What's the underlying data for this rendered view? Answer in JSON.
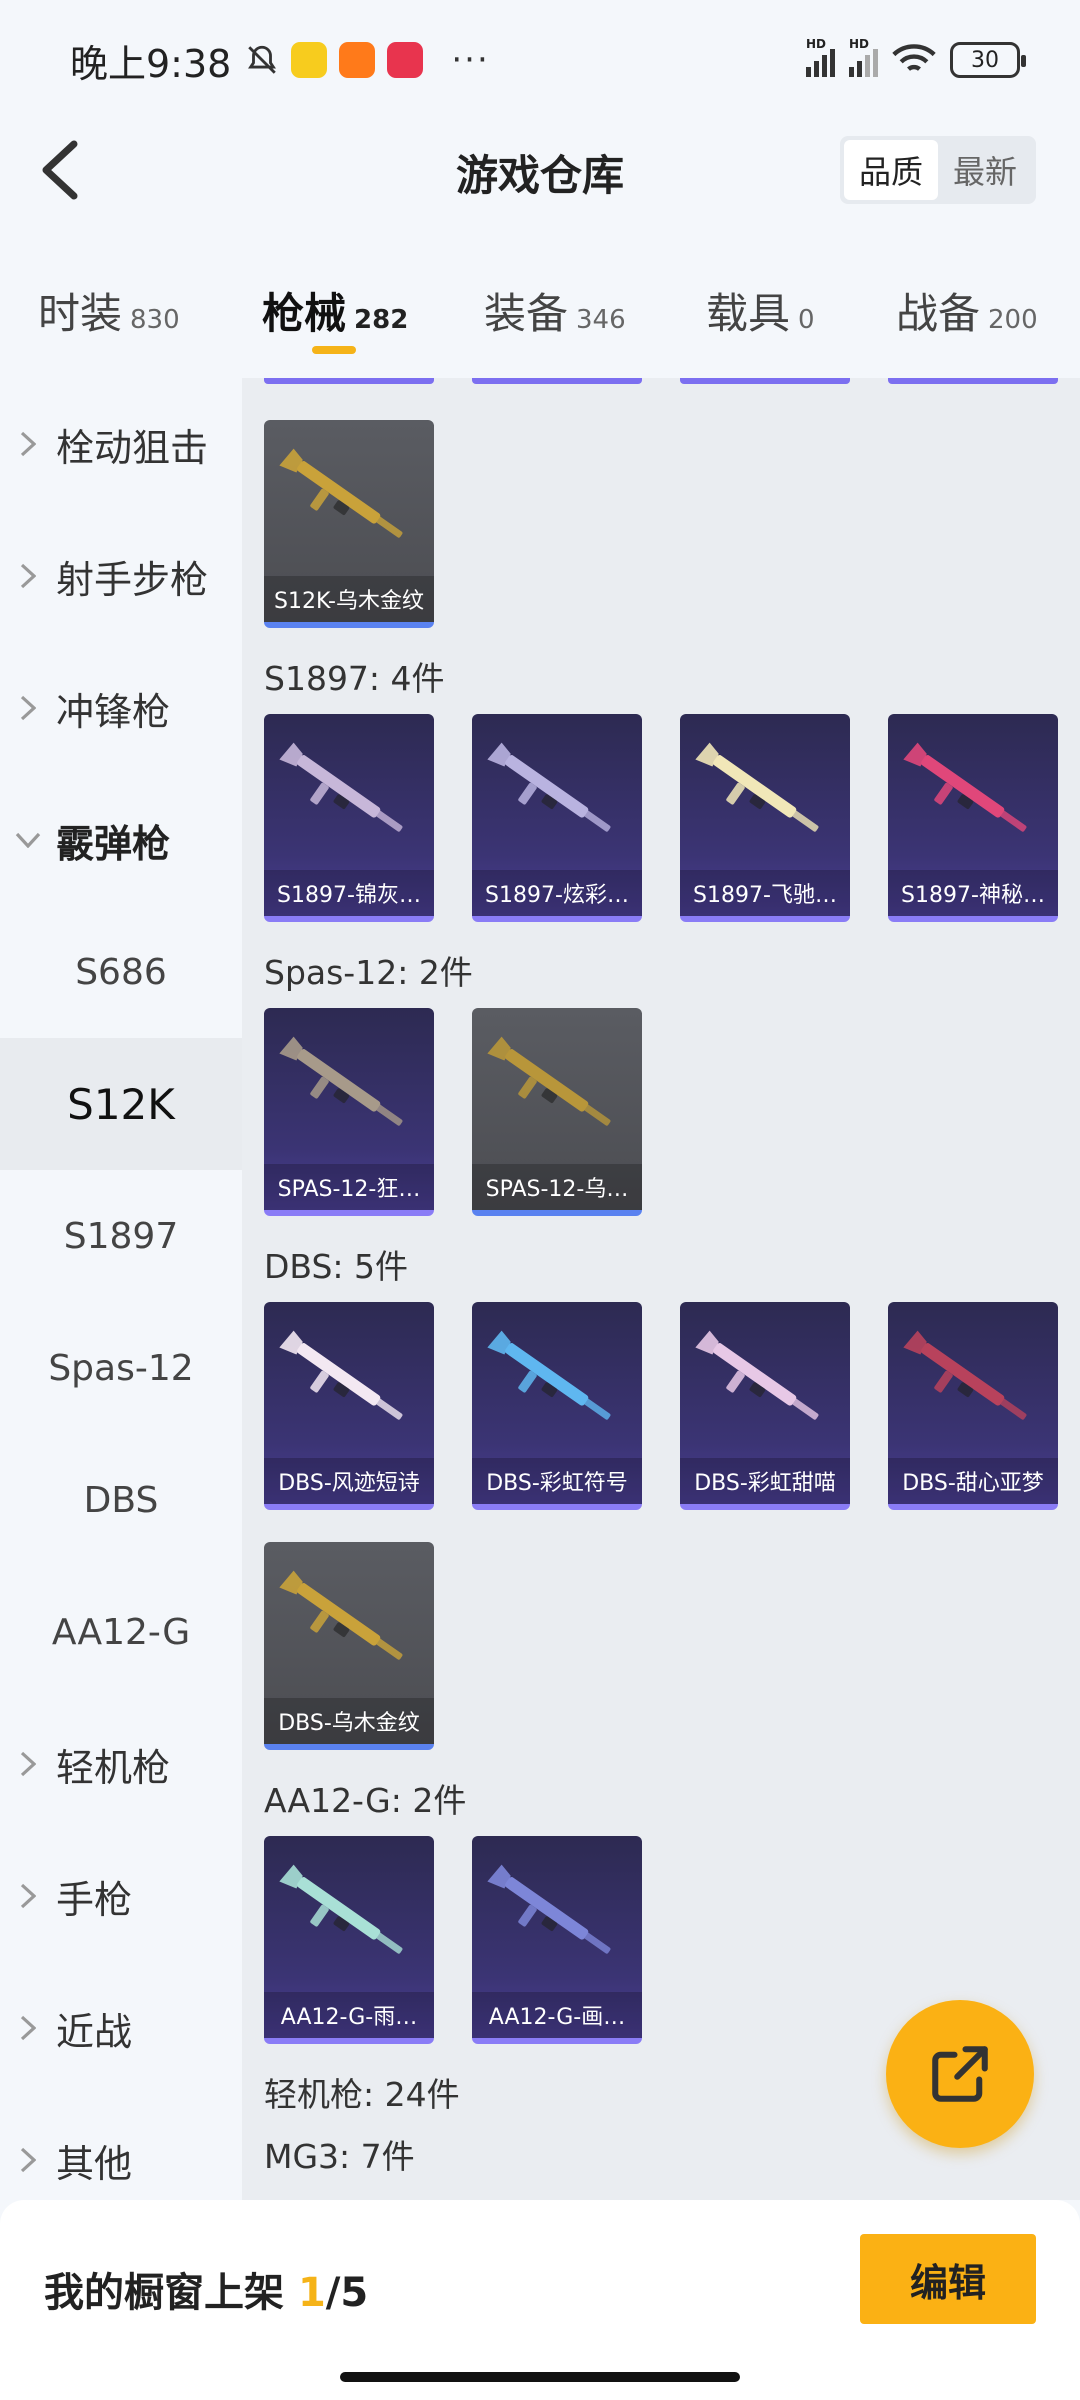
{
  "status_bar": {
    "time": "晚上9:38",
    "dots": "···",
    "hd_labels": [
      "HD",
      "HD"
    ],
    "battery": "30"
  },
  "header": {
    "title": "游戏仓库",
    "sort_options": [
      "品质",
      "最新"
    ],
    "sort_active": "品质"
  },
  "tabs": [
    {
      "label": "时装",
      "count": "830"
    },
    {
      "label": "枪械",
      "count": "282"
    },
    {
      "label": "装备",
      "count": "346"
    },
    {
      "label": "载具",
      "count": "0"
    },
    {
      "label": "战备",
      "count": "200"
    }
  ],
  "active_tab": "枪械",
  "sidebar": [
    {
      "label": "栓动狙击",
      "type": "category"
    },
    {
      "label": "射手步枪",
      "type": "category"
    },
    {
      "label": "冲锋枪",
      "type": "category"
    },
    {
      "label": "霰弹枪",
      "type": "category-open"
    },
    {
      "label": "S686",
      "type": "sub"
    },
    {
      "label": "S12K",
      "type": "sub-selected"
    },
    {
      "label": "S1897",
      "type": "sub"
    },
    {
      "label": "Spas-12",
      "type": "sub"
    },
    {
      "label": "DBS",
      "type": "sub"
    },
    {
      "label": "AA12-G",
      "type": "sub"
    },
    {
      "label": "轻机枪",
      "type": "category"
    },
    {
      "label": "手枪",
      "type": "category"
    },
    {
      "label": "近战",
      "type": "category"
    },
    {
      "label": "其他",
      "type": "category"
    }
  ],
  "groups": [
    {
      "title": "",
      "items": [
        {
          "name": "S12K-乌木金纹",
          "style": "gray",
          "gun_color": "#c9a23a"
        }
      ]
    },
    {
      "title": "S1897: 4件",
      "items": [
        {
          "name": "S1897-锦灰…",
          "style": "purple",
          "gun_color": "#c7b7d9"
        },
        {
          "name": "S1897-炫彩…",
          "style": "purple",
          "gun_color": "#b9b3e0"
        },
        {
          "name": "S1897-飞驰…",
          "style": "purple",
          "gun_color": "#f1e7b8"
        },
        {
          "name": "S1897-神秘…",
          "style": "purple",
          "gun_color": "#e0477a"
        }
      ]
    },
    {
      "title": "Spas-12: 2件",
      "items": [
        {
          "name": "SPAS-12-狂…",
          "style": "purple",
          "gun_color": "#a79a8a"
        },
        {
          "name": "SPAS-12-乌…",
          "style": "gray",
          "gun_color": "#b8963a"
        }
      ]
    },
    {
      "title": "DBS: 5件",
      "items": [
        {
          "name": "DBS-风迹短诗",
          "style": "purple",
          "gun_color": "#f3e8f2"
        },
        {
          "name": "DBS-彩虹符号",
          "style": "purple",
          "gun_color": "#5fb7f0"
        },
        {
          "name": "DBS-彩虹甜喵",
          "style": "purple",
          "gun_color": "#e7c8e6"
        },
        {
          "name": "DBS-甜心亚梦",
          "style": "purple",
          "gun_color": "#b8425c"
        },
        {
          "name": "DBS-乌木金纹",
          "style": "gray",
          "gun_color": "#c9a23a"
        }
      ]
    },
    {
      "title": "AA12-G: 2件",
      "items": [
        {
          "name": "AA12-G-雨…",
          "style": "purple",
          "gun_color": "#a9e0d6"
        },
        {
          "name": "AA12-G-画…",
          "style": "purple",
          "gun_color": "#7d86d8"
        }
      ]
    },
    {
      "title": "轻机枪: 24件",
      "items": []
    },
    {
      "title": "MG3: 7件",
      "items": []
    }
  ],
  "bottom": {
    "label_prefix": "我的橱窗上架 ",
    "current": "1",
    "total": "/5",
    "edit_label": "编辑"
  },
  "colors": {
    "accent": "#fbb114",
    "rarity_purple": "#8a7cf6",
    "rarity_blue": "#5a82f0"
  },
  "icons": {
    "back": "chevron-left-icon",
    "share": "share-out-icon",
    "expand": "chevron-right-icon",
    "collapse": "chevron-down-icon"
  }
}
